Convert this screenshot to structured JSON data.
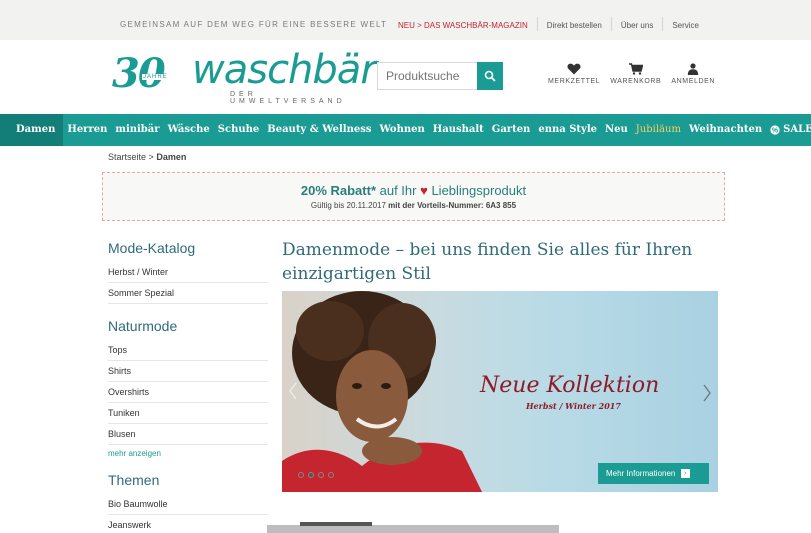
{
  "topbar": {
    "slogan": "GEMEINSAM AUF DEM WEG FÜR EINE BESSERE WELT",
    "links": [
      "NEU > DAS WASCHBÄR-MAGAZIN",
      "Direkt bestellen",
      "Über uns",
      "Service"
    ]
  },
  "header": {
    "logo_number": "30",
    "logo_jahre": "JAHRE",
    "logo_name": "waschbär",
    "logo_sub": "DER UMWELTVERSAND",
    "search_placeholder": "Produktsuche",
    "icons": [
      {
        "name": "heart-icon",
        "label": "MERKZETTEL"
      },
      {
        "name": "cart-icon",
        "label": "WARENKORB"
      },
      {
        "name": "user-icon",
        "label": "ANMELDEN"
      }
    ]
  },
  "nav": {
    "items": [
      "Damen",
      "Herren",
      "minibär",
      "Wäsche",
      "Schuhe",
      "Beauty & Wellness",
      "Wohnen",
      "Haushalt",
      "Garten",
      "enna Style",
      "Neu",
      "Jubiläum",
      "Weihnachten",
      "SALE"
    ],
    "active_index": 0
  },
  "breadcrumb": {
    "home": "Startseite",
    "sep": ">",
    "current": "Damen"
  },
  "promo": {
    "percent": "20% Rabatt*",
    "mid": "auf Ihr",
    "heart": "♥",
    "product": "Lieblingsprodukt",
    "valid_prefix": "Gültig bis 20.11.2017",
    "valid_bold": "mit der Vorteils-Nummer: 6A3 855"
  },
  "sidebar": {
    "sections": [
      {
        "title": "Mode-Katalog",
        "items": [
          "Herbst / Winter",
          "Sommer Spezial"
        ]
      },
      {
        "title": "Naturmode",
        "items": [
          "Tops",
          "Shirts",
          "Overshirts",
          "Tuniken",
          "Blusen"
        ],
        "more": "mehr anzeigen"
      },
      {
        "title": "Themen",
        "items": [
          "Bio Baumwolle",
          "Jeanswerk"
        ]
      }
    ]
  },
  "main": {
    "title": "Damenmode – bei uns finden Sie alles für Ihren einzigartigen Stil",
    "hero": {
      "headline": "Neue Kollektion",
      "season": "Herbst / Winter 2017",
      "cta": "Mehr Informationen"
    }
  },
  "colors": {
    "brand": "#1a9b93",
    "brand_dark": "#137e77",
    "accent_red": "#c42333",
    "headline": "#2f6b79",
    "gold": "#f4d25e"
  }
}
